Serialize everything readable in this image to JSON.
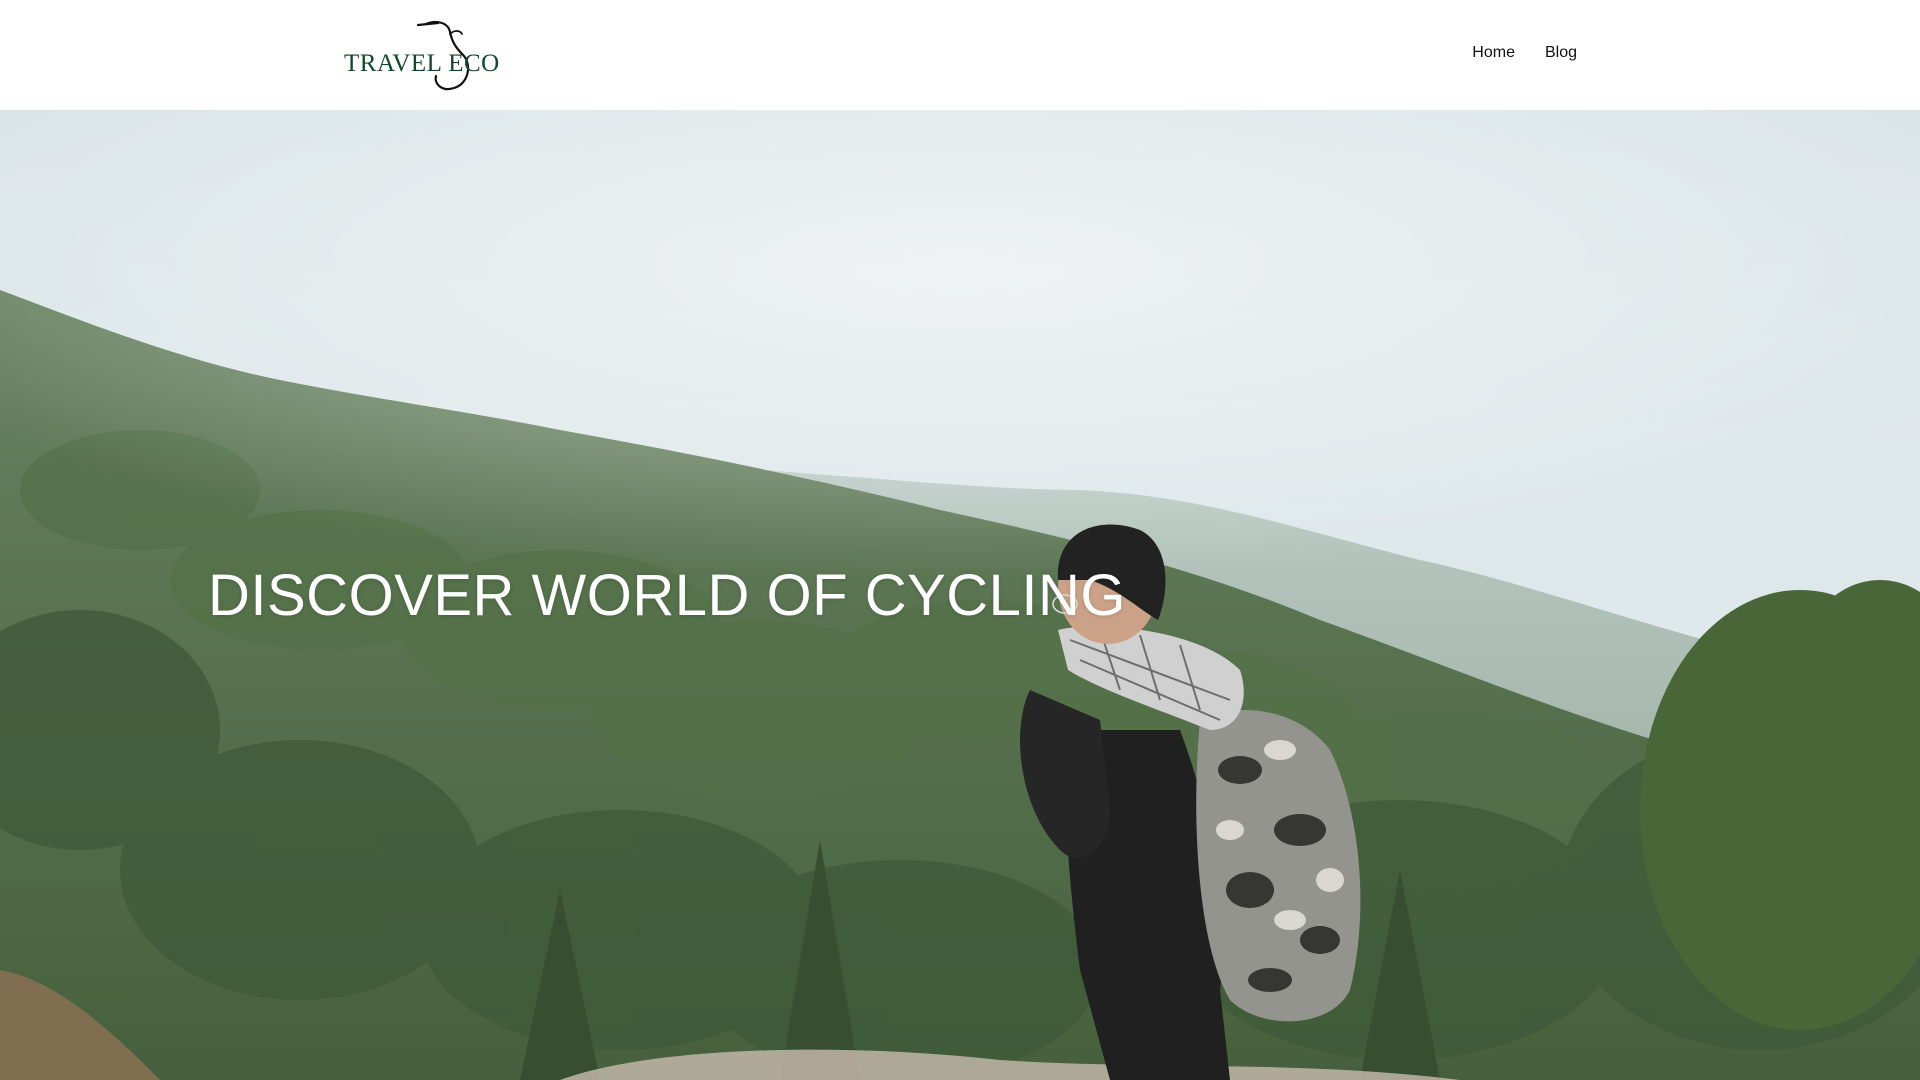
{
  "header": {
    "logo_text": "TRAVEL ECO",
    "nav": [
      {
        "label": "Home"
      },
      {
        "label": "Blog"
      }
    ]
  },
  "hero": {
    "title": "DISCOVER WORLD OF CYCLING",
    "image_subject": "hiker-with-camo-backpack-on-misty-mountain"
  },
  "colors": {
    "logo_green": "#0f4a2a",
    "nav_text": "#111111",
    "hero_title": "#ffffff",
    "header_bg": "#ffffff"
  }
}
